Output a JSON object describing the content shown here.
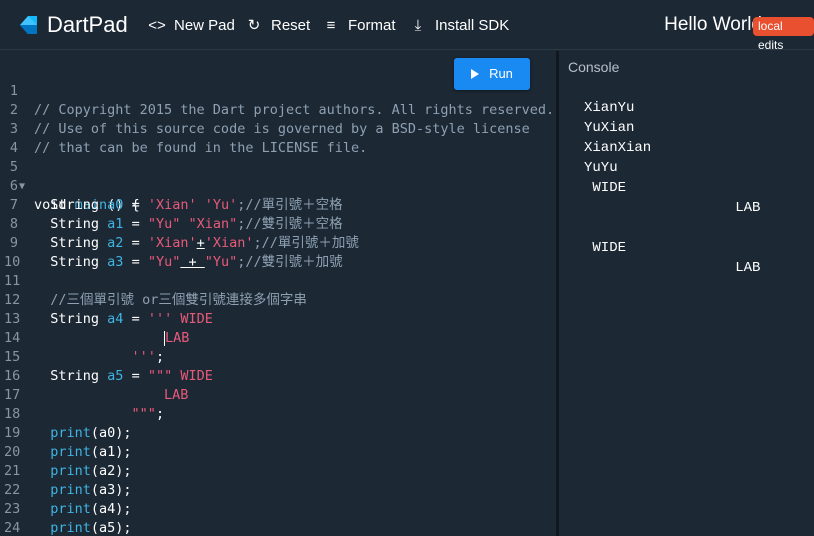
{
  "header": {
    "app_name": "DartPad",
    "new_pad": "New Pad",
    "reset": "Reset",
    "format": "Format",
    "install_sdk": "Install SDK",
    "pad_title": "Hello World",
    "badge": "local edits"
  },
  "editor": {
    "run_label": "Run",
    "line_numbers": [
      "1",
      "2",
      "3",
      "4",
      "5",
      "6",
      "7",
      "8",
      "9",
      "10",
      "11",
      "12",
      "13",
      "14",
      "15",
      "16",
      "17",
      "18",
      "19",
      "20",
      "21",
      "22",
      "23",
      "24"
    ],
    "lines": {
      "l1": "// Copyright 2015 the Dart project authors. All rights reserved.",
      "l2": "// Use of this source code is governed by a BSD-style license",
      "l3": "// that can be found in the LICENSE file.",
      "l5_kw": "void",
      "l5_fn": "main",
      "l5_rest": "() {",
      "l6_a": "String ",
      "l6_b": "a0",
      "l6_c": " = ",
      "l6_d": "'Xian' 'Yu'",
      "l6_e": ";//單引號＋空格",
      "l7_a": "String ",
      "l7_b": "a1",
      "l7_c": " = ",
      "l7_d": "\"Yu\" \"Xian\"",
      "l7_e": ";//雙引號＋空格",
      "l8_a": "String ",
      "l8_b": "a2",
      "l8_c": " = ",
      "l8_d": "'Xian'",
      "l8_op": "+",
      "l8_f": "'Xian'",
      "l8_e": ";//單引號＋加號",
      "l9_a": "String ",
      "l9_b": "a3",
      "l9_c": " = ",
      "l9_d": "\"Yu\"",
      "l9_op": " + ",
      "l9_f": "\"Yu\"",
      "l9_e": ";//雙引號＋加號",
      "l11": "//三個單引號 or三個雙引號連接多個字串",
      "l12_a": "String ",
      "l12_b": "a4",
      "l12_c": " = ",
      "l12_d": "''' WIDE",
      "l13": "LAB",
      "l14_d": "'''",
      "l14_e": ";",
      "l15_a": "String ",
      "l15_b": "a5",
      "l15_c": " = ",
      "l15_d": "\"\"\" WIDE",
      "l16": "LAB",
      "l17_d": "\"\"\"",
      "l17_e": ";",
      "print_fn": "print",
      "l18_arg": "(a0);",
      "l19_arg": "(a1);",
      "l20_arg": "(a2);",
      "l21_arg": "(a3);",
      "l22_arg": "(a4);",
      "l23_arg": "(a5);",
      "l24": "}"
    }
  },
  "console": {
    "title": "Console",
    "output": [
      "XianYu",
      "YuXian",
      "XianXian",
      "YuYu",
      " WIDE",
      "                  LAB",
      "",
      " WIDE",
      "                  LAB"
    ]
  },
  "colors": {
    "background": "#1c2834",
    "run_button": "#1a8af3",
    "badge": "#e9502f",
    "string": "#e85a7a",
    "identifier": "#3fb4e3",
    "comment": "#8ea0b1"
  }
}
